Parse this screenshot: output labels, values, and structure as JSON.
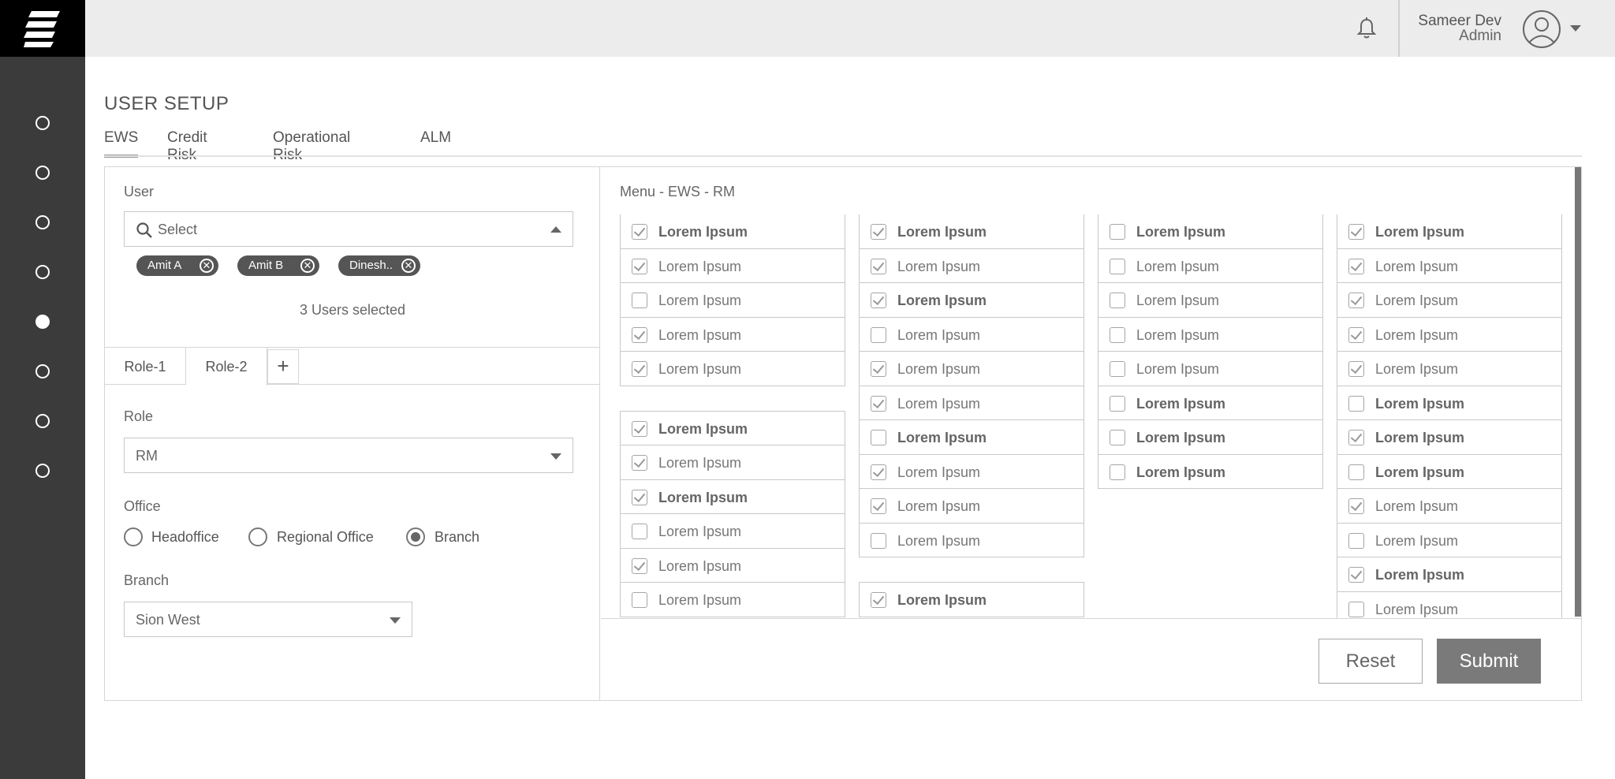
{
  "header": {
    "user_name": "Sameer Dev",
    "user_role": "Admin"
  },
  "page": {
    "title": "USER SETUP",
    "tabs": [
      "EWS",
      "Credit Risk",
      "Operational Risk",
      "ALM"
    ],
    "active_tab": "EWS"
  },
  "user_section": {
    "label": "User",
    "placeholder": "Select",
    "chips": [
      "Amit A",
      "Amit B",
      "Dinesh.."
    ],
    "chip_remove_glyph": "✕",
    "selected_text": "3 Users selected"
  },
  "role_tabs": {
    "items": [
      "Role-1",
      "Role-2"
    ],
    "active": "Role-2",
    "add_label": "+"
  },
  "role_section": {
    "label": "Role",
    "value": "RM"
  },
  "office_section": {
    "label": "Office",
    "options": [
      "Headoffice",
      "Regional Office",
      "Branch"
    ],
    "selected": "Branch"
  },
  "branch_section": {
    "label": "Branch",
    "value": "Sion West"
  },
  "menu": {
    "title": "Menu - EWS - RM",
    "item_label": "Lorem Ipsum",
    "columns": [
      [
        {
          "c": true,
          "b": true
        },
        {
          "c": true,
          "b": false
        },
        {
          "c": false,
          "b": false
        },
        {
          "c": true,
          "b": false
        },
        {
          "c": true,
          "b": false
        },
        {
          "gap": true
        },
        {
          "c": true,
          "b": true
        },
        {
          "c": true,
          "b": false
        },
        {
          "c": true,
          "b": true
        },
        {
          "c": false,
          "b": false
        },
        {
          "c": true,
          "b": false
        },
        {
          "c": false,
          "b": false
        }
      ],
      [
        {
          "c": true,
          "b": true
        },
        {
          "c": true,
          "b": false
        },
        {
          "c": true,
          "b": true
        },
        {
          "c": false,
          "b": false
        },
        {
          "c": true,
          "b": false
        },
        {
          "c": true,
          "b": false
        },
        {
          "c": false,
          "b": true
        },
        {
          "c": true,
          "b": false
        },
        {
          "c": true,
          "b": false
        },
        {
          "c": false,
          "b": false
        },
        {
          "gap": true
        },
        {
          "c": true,
          "b": true
        }
      ],
      [
        {
          "c": false,
          "b": true
        },
        {
          "c": false,
          "b": false
        },
        {
          "c": false,
          "b": false
        },
        {
          "c": false,
          "b": false
        },
        {
          "c": false,
          "b": false
        },
        {
          "c": false,
          "b": true
        },
        {
          "c": false,
          "b": true
        },
        {
          "c": false,
          "b": true
        }
      ],
      [
        {
          "c": true,
          "b": true
        },
        {
          "c": true,
          "b": false
        },
        {
          "c": true,
          "b": false
        },
        {
          "c": true,
          "b": false
        },
        {
          "c": true,
          "b": false
        },
        {
          "c": false,
          "b": true
        },
        {
          "c": true,
          "b": true
        },
        {
          "c": false,
          "b": true
        },
        {
          "c": true,
          "b": false
        },
        {
          "c": false,
          "b": false
        },
        {
          "c": true,
          "b": true
        },
        {
          "c": false,
          "b": false
        }
      ]
    ]
  },
  "actions": {
    "reset": "Reset",
    "submit": "Submit"
  }
}
